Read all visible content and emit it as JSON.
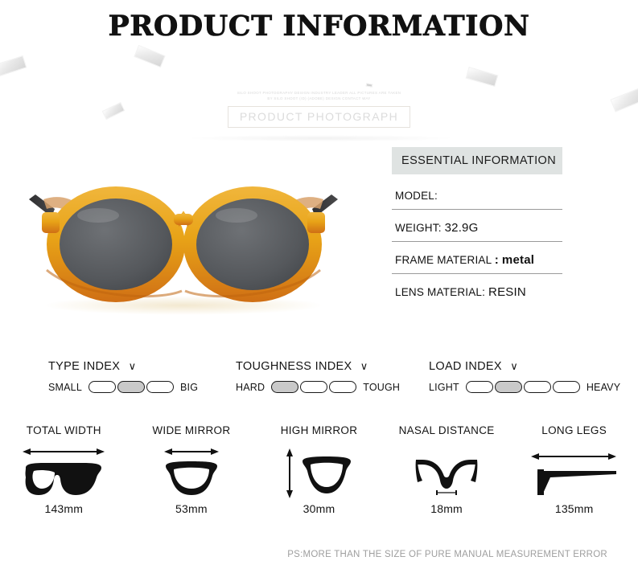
{
  "page": {
    "title": "PRODUCT INFORMATION"
  },
  "watermark": {
    "tiny_line1": "SILO SHOOT PHOTOGRAPHY DESIGN INDUSTRY LEADER ALL PICTURES ARE TAKEN",
    "tiny_line2": "BY SILO SHOOT (ID) (ADOBE) DESIGN CONTACT WAY",
    "box_label": "PRODUCT PHOTOGRAPH"
  },
  "product_photo": {
    "alt_name": "amber-sunglasses",
    "frame_color": "#e8a317",
    "frame_color_dark": "#d4741a",
    "lens_color": "#5a5d61",
    "temple_color": "#3a3a3c"
  },
  "essential_information": {
    "heading": "ESSENTIAL INFORMATION",
    "heading_bg": "#dfe3e2",
    "rows": [
      {
        "label": "MODEL:",
        "value": ""
      },
      {
        "label": "WEIGHT:",
        "value": "32.9G",
        "bold": false
      },
      {
        "label": "FRAME MATERIAL",
        "separator": ":",
        "value": "metal",
        "bold": true
      },
      {
        "label": "LENS MATERIAL:",
        "value": "RESIN",
        "bold": false
      }
    ]
  },
  "indices": [
    {
      "title": "TYPE INDEX",
      "chevron": "∨",
      "left_cap": "SMALL",
      "right_cap": "BIG",
      "steps": 3,
      "active": 2
    },
    {
      "title": "TOUGHNESS INDEX",
      "chevron": "∨",
      "left_cap": "HARD",
      "right_cap": "TOUGH",
      "steps": 3,
      "active": 1
    },
    {
      "title": "LOAD INDEX",
      "chevron": "∨",
      "left_cap": "LIGHT",
      "right_cap": "HEAVY",
      "steps": 4,
      "active": 2
    }
  ],
  "measurements": [
    {
      "header": "TOTAL WIDTH",
      "icon": "glasses-full-width-icon",
      "value": "143mm"
    },
    {
      "header": "WIDE MIRROR",
      "icon": "lens-width-icon",
      "value": "53mm"
    },
    {
      "header": "HIGH MIRROR",
      "icon": "lens-height-icon",
      "value": "30mm"
    },
    {
      "header": "NASAL DISTANCE",
      "icon": "bridge-width-icon",
      "value": "18mm"
    },
    {
      "header": "LONG LEGS",
      "icon": "temple-length-icon",
      "value": "135mm"
    }
  ],
  "footer": {
    "note": "PS:MORE THAN THE SIZE OF PURE MANUAL MEASUREMENT ERROR"
  },
  "colors": {
    "pill_active": "#c9c9c9",
    "pill_border": "#1a1a1a",
    "rule": "#9a9a9a",
    "muted_text": "#9e9e9e"
  }
}
